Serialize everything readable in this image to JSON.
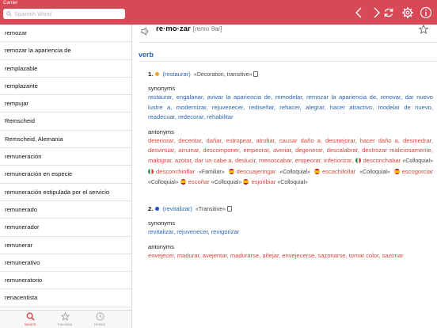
{
  "status": {
    "carrier": "Carrier"
  },
  "search": {
    "placeholder": "Spanish Word",
    "value": ""
  },
  "header_icons": [
    "chevron-left-icon",
    "chevron-right-icon",
    "refresh-icon",
    "gear-icon",
    "info-icon"
  ],
  "sidebar": {
    "items": [
      "remozar",
      "remozar la apariencia de",
      "remplazable",
      "remplazante",
      "rempujar",
      "Remscheid",
      "Remscheid, Alemania",
      "remuneración",
      "remuneración en especie",
      "remuneración estipulada por el servicio",
      "remunerado",
      "remunerador",
      "remunerar",
      "remunerativo",
      "remuneratorio",
      "renacentista",
      "renacer"
    ]
  },
  "tabs": [
    {
      "label": "Search",
      "icon": "search-icon",
      "active": true
    },
    {
      "label": "Favorites",
      "icon": "star-icon",
      "active": false
    },
    {
      "label": "History",
      "icon": "clock-icon",
      "active": false
    }
  ],
  "entry": {
    "headword": "re·mo·zar",
    "pronunciation": "[remoˈθar]",
    "pos": "verb",
    "senses": [
      {
        "number": "1.",
        "dot_color": "#f0a020",
        "gloss": "(restaurar)",
        "tags": "«Decoration, transitive»",
        "synonyms_label": "synonyms",
        "synonyms": "restaurar, engalanar, avivar la apariencia de, remodelar, remozar la apariencia de, renovar, dar nuevo lustre a, modernizar, rejuvenecer, rediseñar, rehacer, alegrar, hacer atractivo, modelar de nuevo, readecuar, redecorar, rehabilitar",
        "antonyms_label": "antonyms",
        "antonyms_plain": "deteriorar, decentar, dañar, estropear, atrofiar, causar daño a, desmejorar, hacer daño a, desmedrar, desvirtuar, arruinar, descomponer, empeorar, averiar, degenerar, descalabrar, destrozar maliciosamente, malograr, azotar, dar un cabe a, deslucir, menoscabar, empeorar, inferiorizar,",
        "antonyms_regional": [
          {
            "word": "desconchabar",
            "register": "«Colloquial»",
            "flag": "mx"
          },
          {
            "word": "desconchinflar",
            "register": "«Familiar»",
            "flag": "mx"
          },
          {
            "word": "descuajeringar",
            "register": "«Colloquial»",
            "flag": "es"
          },
          {
            "word": "escachifollar",
            "register": "«Colloquial»",
            "flag": "es"
          },
          {
            "word": "escogorciar",
            "register": "«Colloquial»",
            "flag": "es"
          },
          {
            "word": "escoñar",
            "register": "«Colloquial»",
            "flag": "es"
          },
          {
            "word": "esjoribiar",
            "register": "«Colloquial»",
            "flag": "es"
          }
        ]
      },
      {
        "number": "2.",
        "dot_color": "#2050d8",
        "gloss": "(revitalizar)",
        "tags": "«Transitive»",
        "synonyms_label": "synonyms",
        "synonyms": "revitalizar, rejuvenecer, revigorizar",
        "antonyms_label": "antonyms",
        "antonyms_plain": "envejecer, madurar, avejentar, madurarse, añejar, envejecerse, sazonarse, tomar color, sazonar"
      }
    ]
  },
  "colors": {
    "accent": "#d94855",
    "link_blue": "#2a66b8",
    "antonym_red": "#d8483e"
  }
}
